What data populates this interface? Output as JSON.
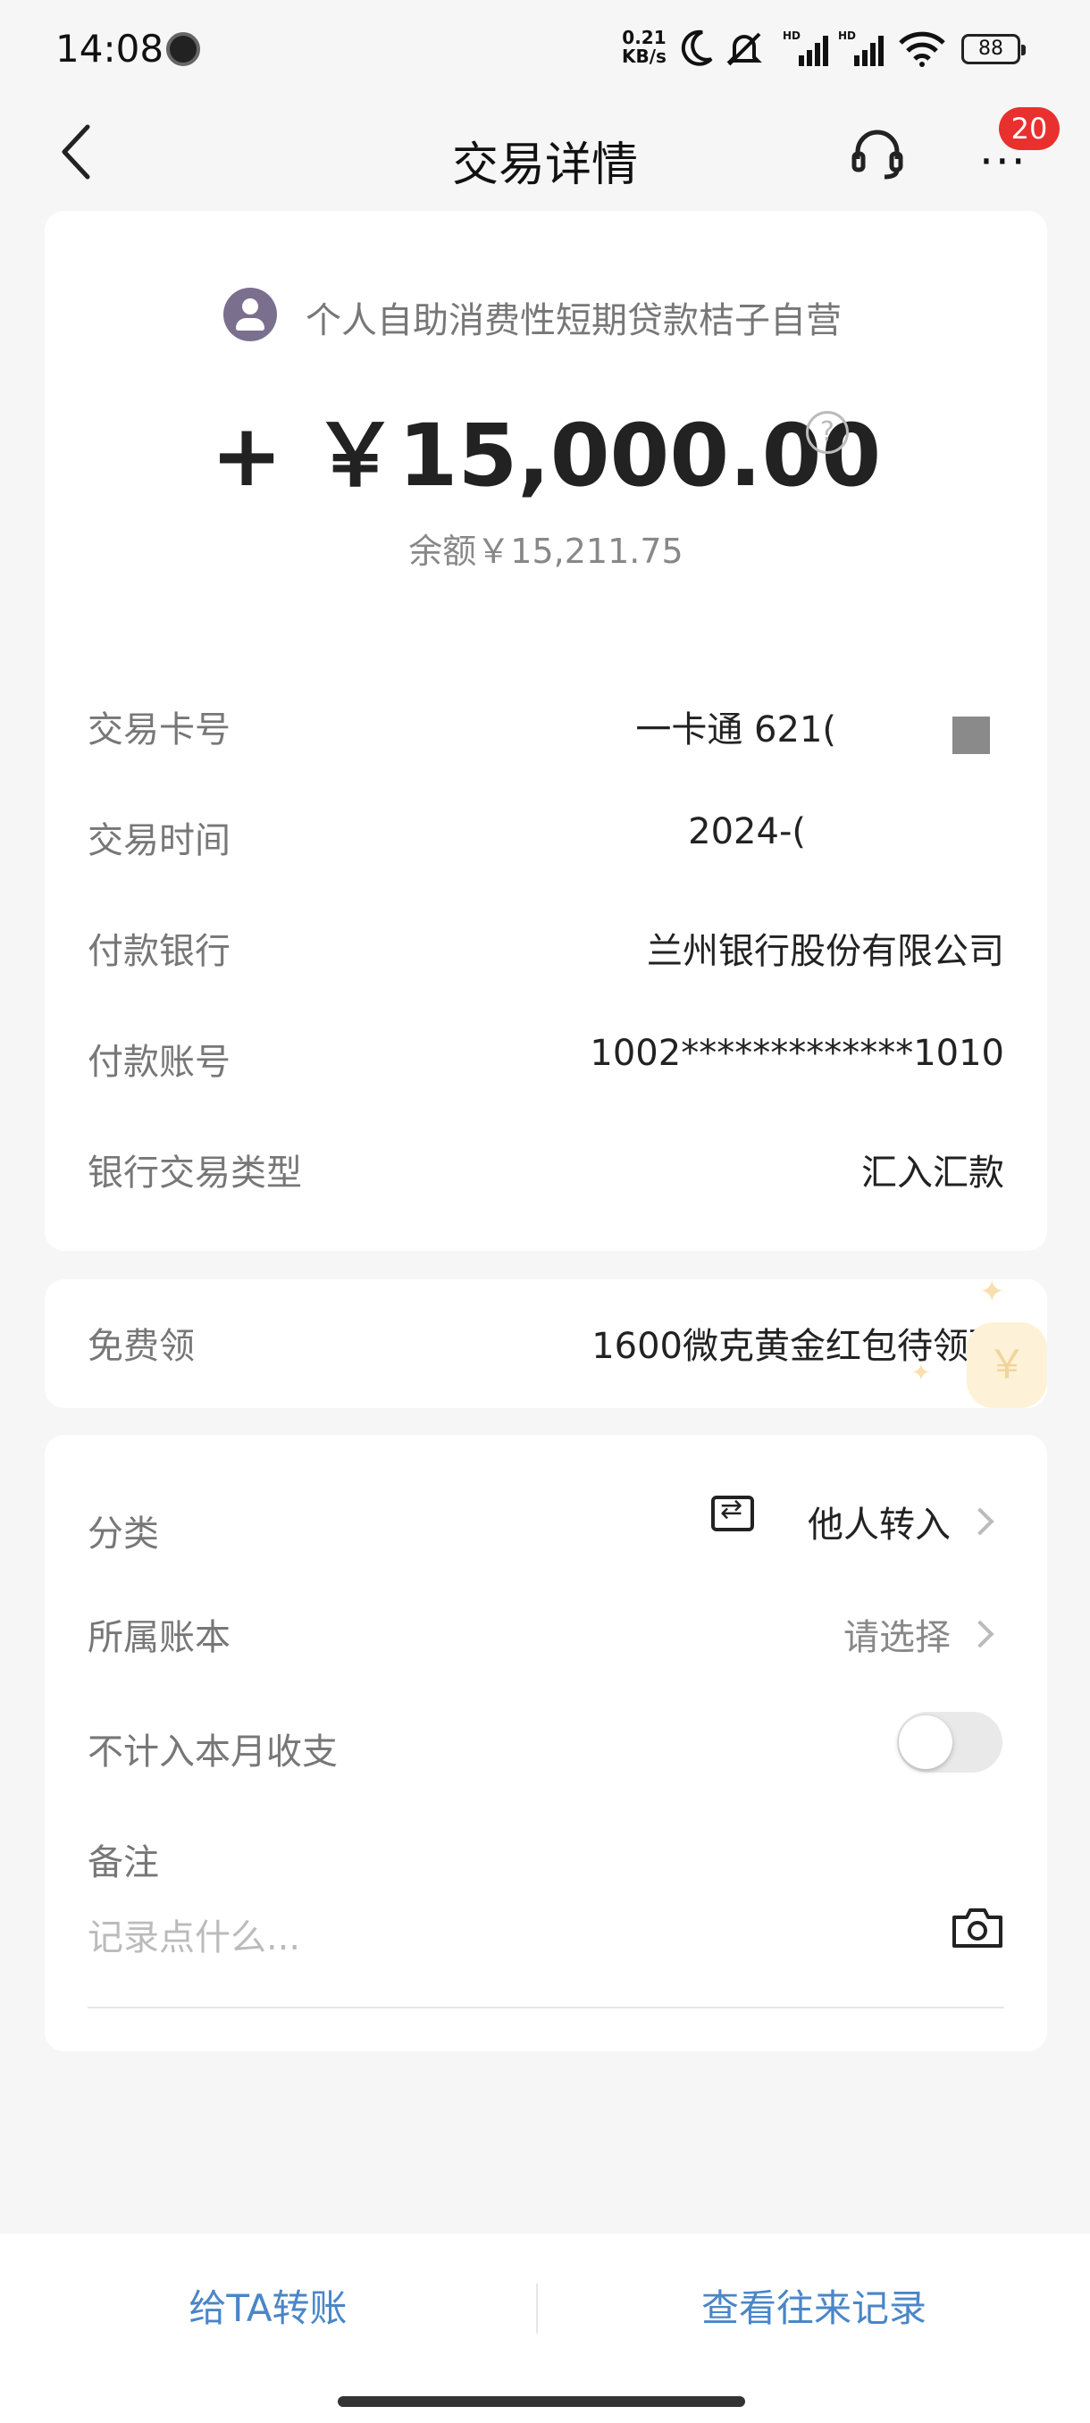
{
  "status_bar": {
    "time": "14:08",
    "net_speed_value": "0.21",
    "net_speed_unit": "KB/s",
    "battery": "88"
  },
  "header": {
    "title": "交易详情",
    "badge_count": "20"
  },
  "summary": {
    "merchant": "个人自助消费性短期贷款桔子自营",
    "amount": "+ ￥15,000.00",
    "balance": "余额￥15,211.75"
  },
  "details": [
    {
      "label": "交易卡号",
      "value": "一卡通 621("
    },
    {
      "label": "交易时间",
      "value": "2024-("
    },
    {
      "label": "付款银行",
      "value": "兰州银行股份有限公司"
    },
    {
      "label": "付款账号",
      "value": "1002*************1010"
    },
    {
      "label": "银行交易类型",
      "value": "汇入汇款"
    }
  ],
  "promo": {
    "label": "免费领",
    "value": "1600微克黄金红包待领取"
  },
  "classify": {
    "category_label": "分类",
    "category_value": "他人转入",
    "ledger_label": "所属账本",
    "ledger_value": "请选择",
    "exclude_label": "不计入本月收支",
    "exclude_on": false,
    "note_label": "备注",
    "note_placeholder": "记录点什么..."
  },
  "bottom": {
    "transfer": "给TA转账",
    "history": "查看往来记录"
  },
  "colors": {
    "accent_blue": "#4a86c8",
    "badge_red": "#e8312f"
  }
}
